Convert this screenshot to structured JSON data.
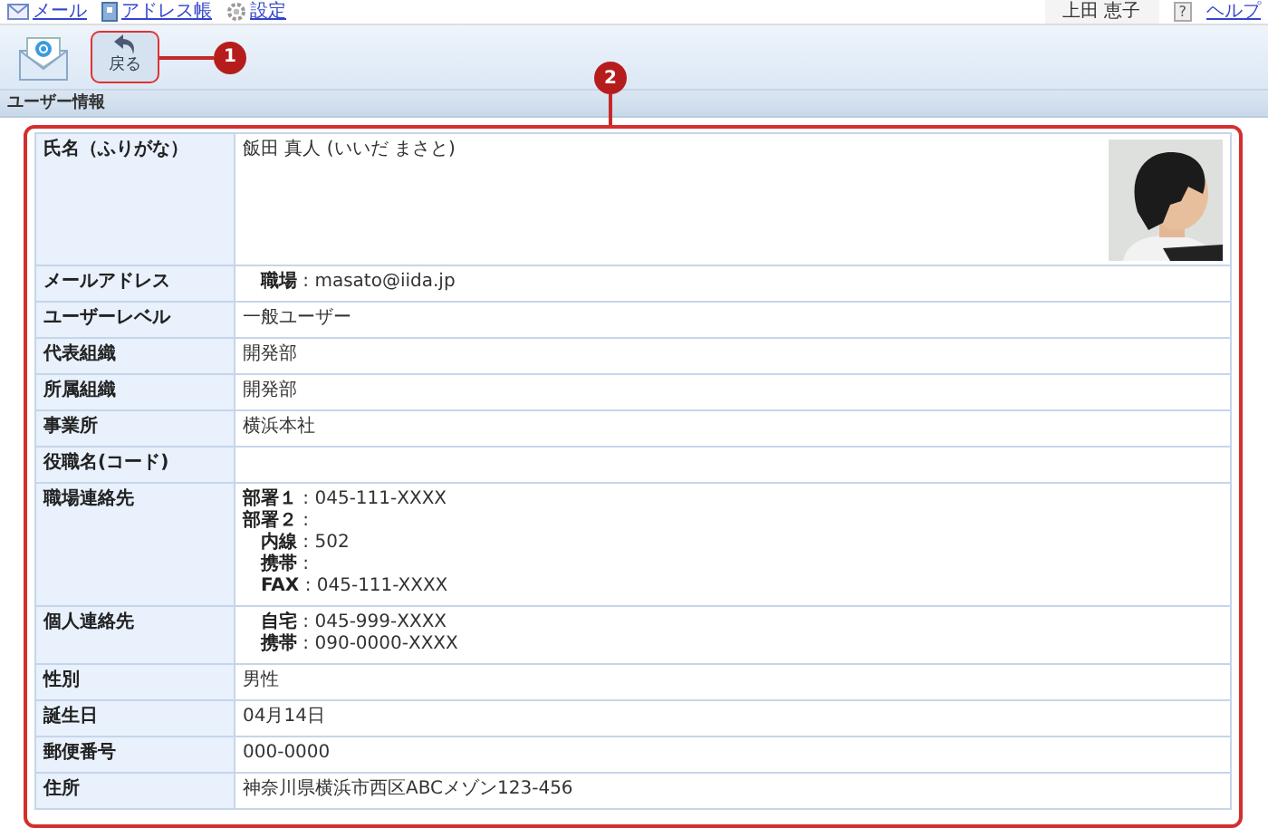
{
  "top_links": [
    {
      "label": "メール"
    },
    {
      "label": "アドレス帳"
    },
    {
      "label": "設定"
    }
  ],
  "user_name": "上田 恵子",
  "help": {
    "icon_label": "?",
    "label": "ヘルプ"
  },
  "toolbar": {
    "back_label": "戻る"
  },
  "callouts": [
    "1",
    "2"
  ],
  "section_title": "ユーザー情報",
  "rows": [
    {
      "label": "氏名（ふりがな）",
      "kind": "text",
      "value": "飯田 真人 (いいだ まさと)"
    },
    {
      "label": "メールアドレス",
      "kind": "contacts",
      "lines": [
        {
          "kind": "item",
          "label": "職場",
          "value": ": masato@iida.jp"
        }
      ]
    },
    {
      "label": "ユーザーレベル",
      "kind": "text",
      "value": "一般ユーザー"
    },
    {
      "label": "代表組織",
      "kind": "text",
      "value": "開発部"
    },
    {
      "label": "所属組織",
      "kind": "text",
      "value": "開発部"
    },
    {
      "label": "事業所",
      "kind": "text",
      "value": "横浜本社"
    },
    {
      "label": "役職名(コード)",
      "kind": "text"
    },
    {
      "label": "職場連絡先",
      "kind": "contacts",
      "lines": [
        {
          "kind": "group",
          "label": "部署１",
          "value": ": 045-111-XXXX"
        },
        {
          "kind": "group",
          "label": "部署２",
          "value": ":"
        },
        {
          "kind": "item",
          "label": "内線",
          "value": ": 502"
        },
        {
          "kind": "item",
          "label": "携帯",
          "value": ":"
        },
        {
          "kind": "item",
          "label": "FAX",
          "value": ": 045-111-XXXX"
        }
      ]
    },
    {
      "label": "個人連絡先",
      "kind": "contacts",
      "lines": [
        {
          "kind": "item",
          "label": "自宅",
          "value": ": 045-999-XXXX"
        },
        {
          "kind": "item",
          "label": "携帯",
          "value": ": 090-0000-XXXX"
        }
      ]
    },
    {
      "label": "性別",
      "kind": "text",
      "value": "男性"
    },
    {
      "label": "誕生日",
      "kind": "text",
      "value": "04月14日"
    },
    {
      "label": "郵便番号",
      "kind": "text",
      "value": "000-0000"
    },
    {
      "label": "住所",
      "kind": "text",
      "value": "神奈川県横浜市西区ABCメゾン123-456"
    }
  ]
}
